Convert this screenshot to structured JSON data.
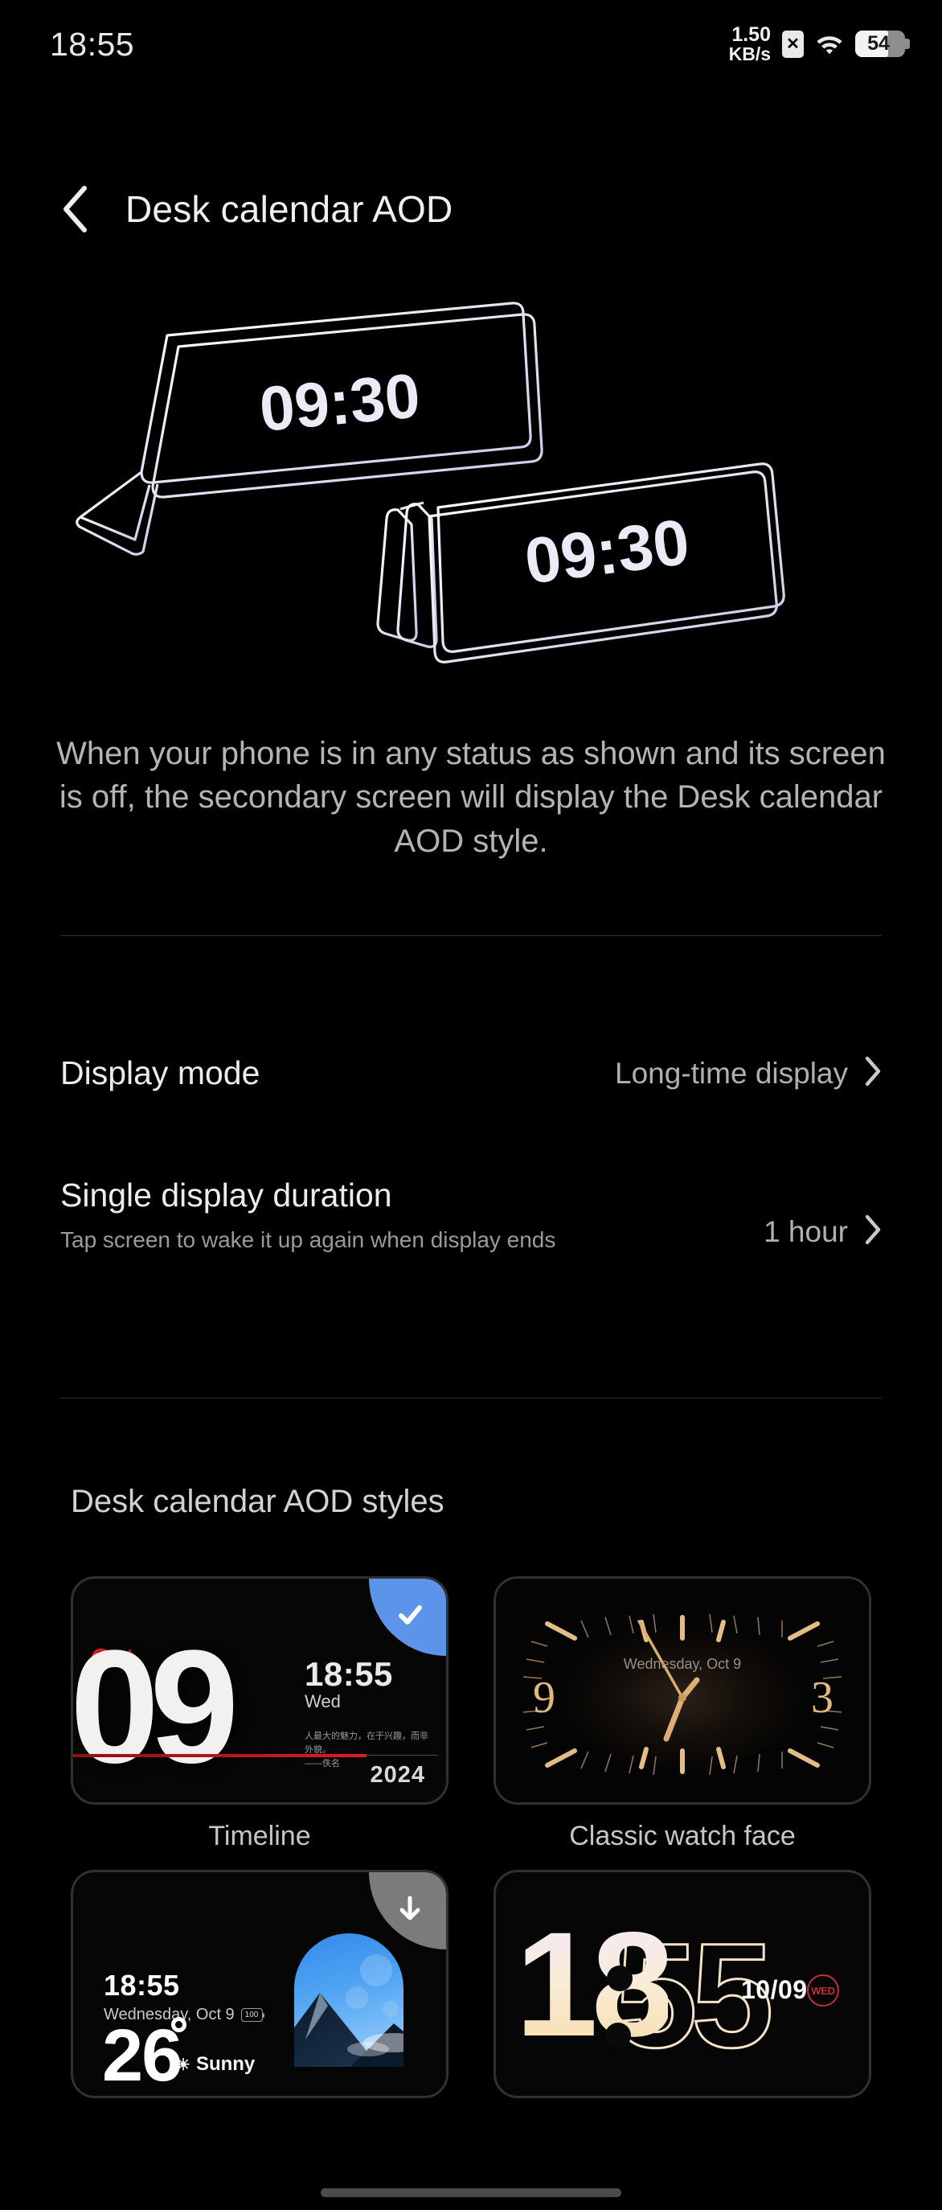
{
  "statusbar": {
    "clock": "18:55",
    "netspeed_rate": "1.50",
    "netspeed_unit": "KB/s",
    "sim_glyph": "✕",
    "battery_level": "54",
    "battery_percent": 54,
    "icons": [
      "sim-card-no-service-icon",
      "wifi-icon",
      "battery-icon"
    ]
  },
  "appbar": {
    "back_label": "‹",
    "title": "Desk calendar AOD"
  },
  "hero": {
    "clock_left": "09:30",
    "clock_right": "09:30",
    "alt": "Two folded phones standing in tent mode showing the time"
  },
  "description": "When your phone is in any status as shown and its screen is off, the secondary screen will display the Desk calendar AOD style.",
  "settings": {
    "rows": [
      {
        "key": "display-mode",
        "title": "Display mode",
        "subtitle": "",
        "value": "Long-time display"
      },
      {
        "key": "single-display-duration",
        "title": "Single display duration",
        "subtitle": "Tap screen to wake it up again when display ends",
        "value": "1 hour"
      }
    ]
  },
  "styles_section": {
    "heading": "Desk calendar AOD styles",
    "items": [
      {
        "key": "timeline",
        "label": "Timeline",
        "badge": "check",
        "selected": true,
        "preview": {
          "month": "Oct.",
          "day": "09",
          "time": "18:55",
          "weekday": "Wed",
          "quote_line1": "人最大的魅力，在于兴趣，而非外貌。",
          "quote_line2": "——佚名",
          "year": "2024"
        }
      },
      {
        "key": "classic-watch-face",
        "label": "Classic watch face",
        "badge": "none",
        "selected": false,
        "preview": {
          "date": "Wednesday, Oct 9",
          "numeral_left": "9",
          "numeral_right": "3",
          "hand_color": "#d8a96a"
        }
      },
      {
        "key": "weather",
        "label": "",
        "badge": "download",
        "selected": false,
        "preview": {
          "time": "18:55",
          "date": "Wednesday, Oct 9",
          "battery": "100",
          "temperature": "26",
          "condition": "Sunny",
          "sun_glyph": "☀"
        }
      },
      {
        "key": "big-digits",
        "label": "",
        "badge": "none",
        "selected": false,
        "preview": {
          "hours": "18",
          "minutes": "55",
          "date": "10/09",
          "weekday": "WED"
        }
      }
    ]
  },
  "colors": {
    "background": "#000000",
    "accent_blue": "#5b94e8",
    "accent_red": "#e02028",
    "gold": "#d8a96a",
    "badge_gray": "#7b7b7b",
    "text_primary": "#ececec",
    "text_secondary": "#9a9a9a"
  },
  "gesture_bar": "home-indicator"
}
